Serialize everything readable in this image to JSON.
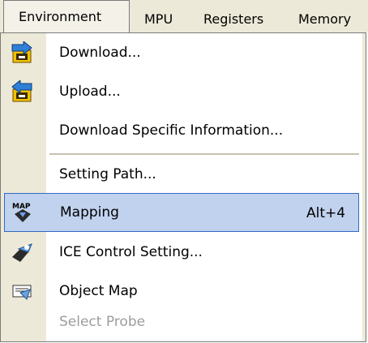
{
  "menubar": {
    "items": [
      {
        "label": "Environment",
        "active": true
      },
      {
        "label": "MPU"
      },
      {
        "label": "Registers"
      },
      {
        "label": "Memory"
      }
    ]
  },
  "menu": {
    "items": [
      {
        "label": "Download...",
        "icon": "download-icon",
        "enabled": true
      },
      {
        "label": "Upload...",
        "icon": "upload-icon",
        "enabled": true
      },
      {
        "label": "Download Specific Information...",
        "enabled": true
      },
      {
        "label": "Setting Path...",
        "enabled": true
      },
      {
        "label": "Mapping",
        "shortcut": "Alt+4",
        "icon": "map-icon",
        "enabled": true,
        "highlighted": true
      },
      {
        "label": "ICE Control Setting...",
        "icon": "ice-control-icon",
        "enabled": true
      },
      {
        "label": "Object Map",
        "icon": "object-map-icon",
        "enabled": true
      },
      {
        "label": "Select Probe",
        "enabled": false
      }
    ]
  },
  "colors": {
    "menu_bg": "#ece9d8",
    "highlight_bg": "#c1d2ee",
    "highlight_border": "#316ac5",
    "disabled_text": "#9d9d9d"
  }
}
